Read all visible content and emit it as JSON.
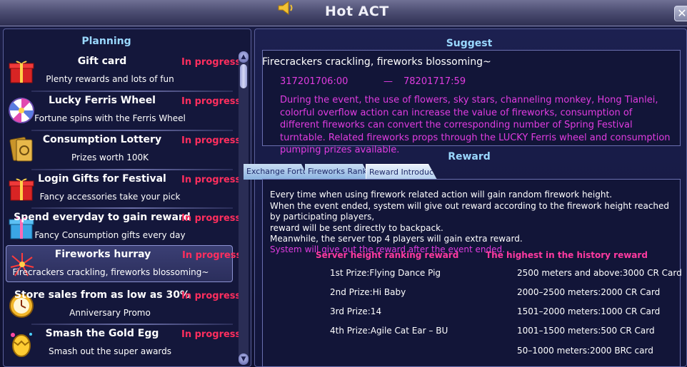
{
  "window": {
    "title": "Hot ACT",
    "title_icon": "speaker-icon",
    "close_label": "✕"
  },
  "planning": {
    "header": "Planning",
    "items": [
      {
        "name": "Gift card",
        "desc": "Plenty rewards and lots of fun",
        "status": "In progress",
        "icon": "gift-box-icon"
      },
      {
        "name": "Lucky Ferris Wheel",
        "desc": "Fortune spins with the Ferris Wheel",
        "status": "In progress",
        "icon": "ferris-wheel-icon"
      },
      {
        "name": "Consumption Lottery",
        "desc": "Prizes worth 100K",
        "status": "In progress",
        "icon": "lottery-cards-icon"
      },
      {
        "name": "Login Gifts for Festival",
        "desc": "Fancy accessories take your pick",
        "status": "In progress",
        "icon": "gift-box-icon"
      },
      {
        "name": "Spend everyday to gain reward",
        "desc": "Fancy Consumption gifts every day",
        "status": "In progress",
        "icon": "gift-box-blue-icon"
      },
      {
        "name": "Fireworks hurray",
        "desc": "Firecrackers crackling, fireworks blossoming~",
        "status": "In progress",
        "icon": "fireworks-icon"
      },
      {
        "name": "Store sales from as low as 30%",
        "desc": "Anniversary Promo",
        "status": "In progress",
        "icon": "clock-icon"
      },
      {
        "name": "Smash the Gold Egg",
        "desc": "Smash out the super awards",
        "status": "In progress",
        "icon": "gold-egg-icon"
      }
    ],
    "selected_index": 5
  },
  "suggest": {
    "header": "Suggest",
    "headline": "Firecrackers crackling, fireworks blossoming~",
    "date_start": "317201706:00",
    "date_dash": "—",
    "date_end": "78201717:59",
    "body": "During the event, the use of flowers, sky stars, channeling monkey, Hong Tianlei, colorful overflow action can increase the value of fireworks, consumption of different fireworks can convert the corresponding number of Spring Festival turntable. Related fireworks props through the LUCKY Ferris wheel and consumption pumping prizes available."
  },
  "reward": {
    "header": "Reward",
    "tabs": [
      "Exchange Fortune",
      "Fireworks Ranking",
      "Reward Introduction"
    ],
    "active_tab": 2,
    "desc_lines": [
      "Every time when using firework related action will gain random firework height.",
      "When the event ended, system will give out reward according to the firework height reached by participating players,",
      "reward will be sent directly to backpack.",
      "Meanwhile, the server top 4 players will gain extra reward."
    ],
    "note": "System will give out the reward after the event ended.",
    "col_server": "Server height ranking reward",
    "col_history": "The highest in the history reward",
    "server_prizes": [
      "1st Prize:Flying Dance Pig",
      "2nd Prize:Hi Baby",
      "3rd Prize:14",
      "4th Prize:Agile Cat Ear – BU"
    ],
    "history_prizes": [
      "2500 meters and above:3000 CR Card",
      "2000–2500 meters:2000 CR Card",
      "1501–2000 meters:1000 CR Card",
      "1001–1500 meters:500 CR Card",
      "50–1000 meters:2000 BRC card"
    ]
  },
  "colors": {
    "status": "#ff2e5e",
    "accent_header": "#9ad8ff",
    "magenta_text": "#e03ce0",
    "pink_heading": "#ff3aa0"
  }
}
